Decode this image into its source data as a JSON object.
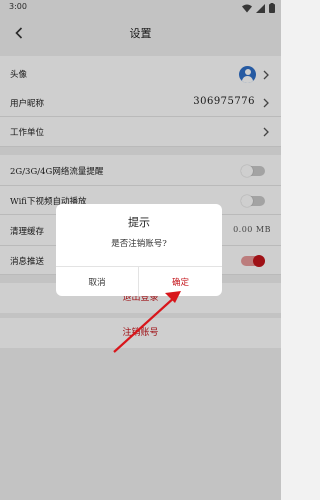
{
  "status_bar": {
    "time": "3:00",
    "icons": [
      "wifi-icon",
      "signal-icon",
      "battery-icon"
    ]
  },
  "header": {
    "title": "设置",
    "back_icon": "chevron-left-icon"
  },
  "settings": {
    "avatar_label": "头像",
    "nickname_label": "用户昵称",
    "nickname_value": "306975776",
    "workplace_label": "工作单位",
    "mobile_data_label": "2G/3G/4G网络流量提醒",
    "mobile_data_on": false,
    "wifi_autoplay_label": "Wifi下视频自动播放",
    "wifi_autoplay_on": false,
    "clear_cache_label": "清理缓存",
    "clear_cache_value": "0.00 MB",
    "push_label": "消息推送",
    "push_on": true
  },
  "actions": {
    "logout": "退出登录",
    "delete_account": "注销账号"
  },
  "dialog": {
    "title": "提示",
    "message": "是否注销账号?",
    "cancel": "取消",
    "confirm": "确定"
  },
  "colors": {
    "accent": "#c4161c",
    "avatar": "#2f6fc8"
  }
}
